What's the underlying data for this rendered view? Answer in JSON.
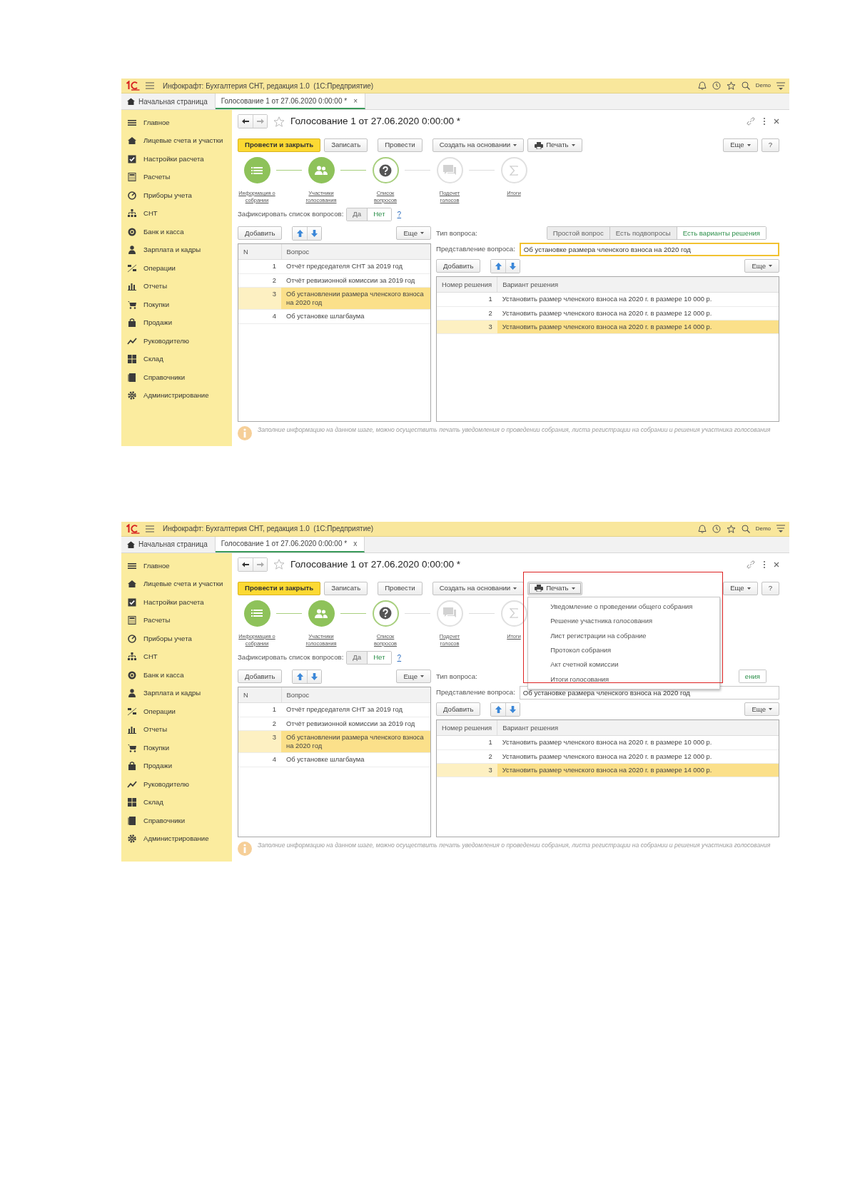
{
  "screens": [
    {
      "app_title": "Инфокрафт: Бухгалтерия СНТ, редакция 1.0  (1С:Предприятие)",
      "user": "Demo",
      "tabs": [
        {
          "label": "Начальная страница",
          "selected": false
        },
        {
          "label": "Голосование 1 от 27.06.2020 0:00:00 *",
          "selected": true,
          "close": "×"
        }
      ],
      "sidebar": [
        "Главное",
        "Лицевые счета и участки",
        "Настройки расчета",
        "Расчеты",
        "Приборы учета",
        "СНТ",
        "Банк и касса",
        "Зарплата и кадры",
        "Операции",
        "Отчеты",
        "Покупки",
        "Продажи",
        "Руководителю",
        "Склад",
        "Справочники",
        "Администрирование"
      ],
      "form": {
        "title": "Голосование 1 от 27.06.2020 0:00:00 *",
        "buttons": [
          {
            "label": "Провести и закрыть",
            "kind": "primary"
          },
          {
            "label": "Записать",
            "kind": "plain"
          },
          {
            "label": "Провести",
            "kind": "plain"
          },
          {
            "label": "Создать на основании",
            "kind": "dropdown"
          },
          {
            "label": "Печать",
            "kind": "print",
            "open": false
          }
        ],
        "more": "Еще",
        "help": "?",
        "steps": [
          {
            "label": "Информация о собрании",
            "done": true,
            "selected": false
          },
          {
            "label": "Участники голосования",
            "done": true,
            "selected": false
          },
          {
            "label": "Список вопросов",
            "done": false,
            "selected": true
          },
          {
            "label": "Подсчет голосов",
            "done": false,
            "selected": false
          },
          {
            "label": "Итоги",
            "done": false,
            "selected": false
          }
        ],
        "fix": {
          "label": "Зафиксировать список вопросов:",
          "options": [
            {
              "label": "Да",
              "selected": false
            },
            {
              "label": "Нет",
              "selected": true
            }
          ],
          "help": "?"
        },
        "questions": {
          "add": "Добавить",
          "more": "Еще",
          "columns": [
            "N",
            "Вопрос"
          ],
          "rows": [
            {
              "n": "1",
              "text": "Отчёт председателя СНТ за 2019 год",
              "selected": false
            },
            {
              "n": "2",
              "text": "Отчёт ревизионной комиссии за 2019 год",
              "selected": false
            },
            {
              "n": "3",
              "text": "Об установлении размера членского взноса на 2020 год",
              "selected": true
            },
            {
              "n": "4",
              "text": "Об установке шлагбаума",
              "selected": false
            }
          ]
        },
        "question_type": {
          "label": "Тип вопроса:",
          "options": [
            {
              "label": "Простой вопрос",
              "selected": false
            },
            {
              "label": "Есть подвопросы",
              "selected": false
            },
            {
              "label": "Есть варианты решения",
              "selected": true
            }
          ]
        },
        "presentation": {
          "label": "Представление вопроса:",
          "value": "Об установке размера членского взноса на 2020 год",
          "focused": true
        },
        "variants": {
          "add": "Добавить",
          "more": "Еще",
          "columns": [
            "Номер решения",
            "Вариант решения"
          ],
          "rows": [
            {
              "n": "1",
              "text": "Установить размер членского взноса на 2020 г. в размере 10 000 р.",
              "selected": false
            },
            {
              "n": "2",
              "text": "Установить размер членского взноса на 2020 г. в размере 12 000 р.",
              "selected": false
            },
            {
              "n": "3",
              "text": "Установить размер членского взноса на 2020 г. в размере 14 000 р.",
              "selected": true
            }
          ]
        },
        "hint": "Заполние информацию на данном шаге, можно осуществить печать уведомления о проведении собрания, листа регистрации на собрании и решения участника голосования"
      }
    },
    {
      "app_title": "Инфокрафт: Бухгалтерия СНТ, редакция 1.0  (1С:Предприятие)",
      "user": "Demo",
      "tabs": [
        {
          "label": "Начальная страница",
          "selected": false
        },
        {
          "label": "Голосование 1 от 27.06.2020 0:00:00 *",
          "selected": true,
          "close": "x"
        }
      ],
      "sidebar": [
        "Главное",
        "Лицевые счета и участки",
        "Настройки расчета",
        "Расчеты",
        "Приборы учета",
        "СНТ",
        "Банк и касса",
        "Зарплата и кадры",
        "Операции",
        "Отчеты",
        "Покупки",
        "Продажи",
        "Руководителю",
        "Склад",
        "Справочники",
        "Администрирование"
      ],
      "form": {
        "title": "Голосование 1 от 27.06.2020 0:00:00 *",
        "buttons": [
          {
            "label": "Провести и закрыть",
            "kind": "primary"
          },
          {
            "label": "Записать",
            "kind": "plain"
          },
          {
            "label": "Провести",
            "kind": "plain"
          },
          {
            "label": "Создать на основании",
            "kind": "dropdown"
          },
          {
            "label": "Печать",
            "kind": "print",
            "open": true
          }
        ],
        "more": "Еще",
        "help": "?",
        "steps": [
          {
            "label": "Информация о собрании",
            "done": true,
            "selected": false
          },
          {
            "label": "Участники голосования",
            "done": true,
            "selected": false
          },
          {
            "label": "Список вопросов",
            "done": false,
            "selected": true
          },
          {
            "label": "Подсчет голосов",
            "done": false,
            "selected": false
          },
          {
            "label": "Итоги",
            "done": false,
            "selected": false
          }
        ],
        "fix": {
          "label": "Зафиксировать список вопросов:",
          "options": [
            {
              "label": "Да",
              "selected": false
            },
            {
              "label": "Нет",
              "selected": true
            }
          ],
          "help": "?"
        },
        "questions": {
          "add": "Добавить",
          "more": "Еще",
          "columns": [
            "N",
            "Вопрос"
          ],
          "rows": [
            {
              "n": "1",
              "text": "Отчёт председателя СНТ за 2019 год",
              "selected": false
            },
            {
              "n": "2",
              "text": "Отчёт ревизионной комиссии за 2019 год",
              "selected": false
            },
            {
              "n": "3",
              "text": "Об установлении размера членского взноса на 2020 год",
              "selected": true
            },
            {
              "n": "4",
              "text": "Об установке шлагбаума",
              "selected": false
            }
          ]
        },
        "question_type": {
          "label": "Тип вопроса:",
          "options": [
            {
              "label": "ения",
              "selected": true
            }
          ]
        },
        "presentation": {
          "label": "Представление вопроса:",
          "value": "Об установке размера членского взноса на 2020 год",
          "focused": false
        },
        "variants": {
          "add": "Добавить",
          "more": "Еще",
          "columns": [
            "Номер решения",
            "Вариант решения"
          ],
          "rows": [
            {
              "n": "1",
              "text": "Установить размер членского взноса на 2020 г. в размере 10 000 р.",
              "selected": false
            },
            {
              "n": "2",
              "text": "Установить размер членского взноса на 2020 г. в размере 12 000 р.",
              "selected": false
            },
            {
              "n": "3",
              "text": "Установить размер членского взноса на 2020 г. в размере 14 000 р.",
              "selected": true
            }
          ]
        },
        "hint": "Заполние информацию на данном шаге, можно осуществить печать уведомления о проведении собрания, листа регистрации на собрании и решения участника голосования"
      },
      "print_menu": {
        "highlighted": true,
        "items": [
          "Уведомление о проведении общего собрания",
          "Решение участника голосования",
          "Лист регистрации на собрание",
          "Протокол собрания",
          "Акт счетной комиссии",
          "Итоги голосования"
        ]
      }
    }
  ]
}
